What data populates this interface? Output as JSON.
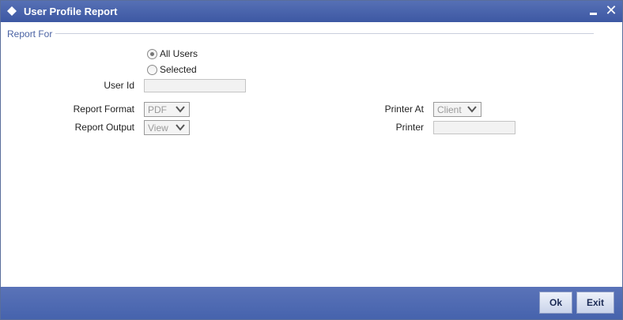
{
  "window": {
    "title": "User Profile Report",
    "minimize_icon": "minimize-icon",
    "close_icon": "close-icon"
  },
  "form": {
    "section_legend": "Report For",
    "radio_all_users": {
      "label": "All Users",
      "checked": true
    },
    "radio_selected": {
      "label": "Selected",
      "checked": false
    },
    "user_id": {
      "label": "User Id",
      "value": ""
    },
    "report_format": {
      "label": "Report Format",
      "value": "PDF"
    },
    "report_output": {
      "label": "Report Output",
      "value": "View"
    },
    "printer_at": {
      "label": "Printer At",
      "value": "Client"
    },
    "printer": {
      "label": "Printer",
      "value": ""
    }
  },
  "footer": {
    "ok_label": "Ok",
    "exit_label": "Exit"
  },
  "colors": {
    "titlebar": "#3d58a3",
    "legend": "#4a62a3",
    "footer": "#4663ad"
  }
}
